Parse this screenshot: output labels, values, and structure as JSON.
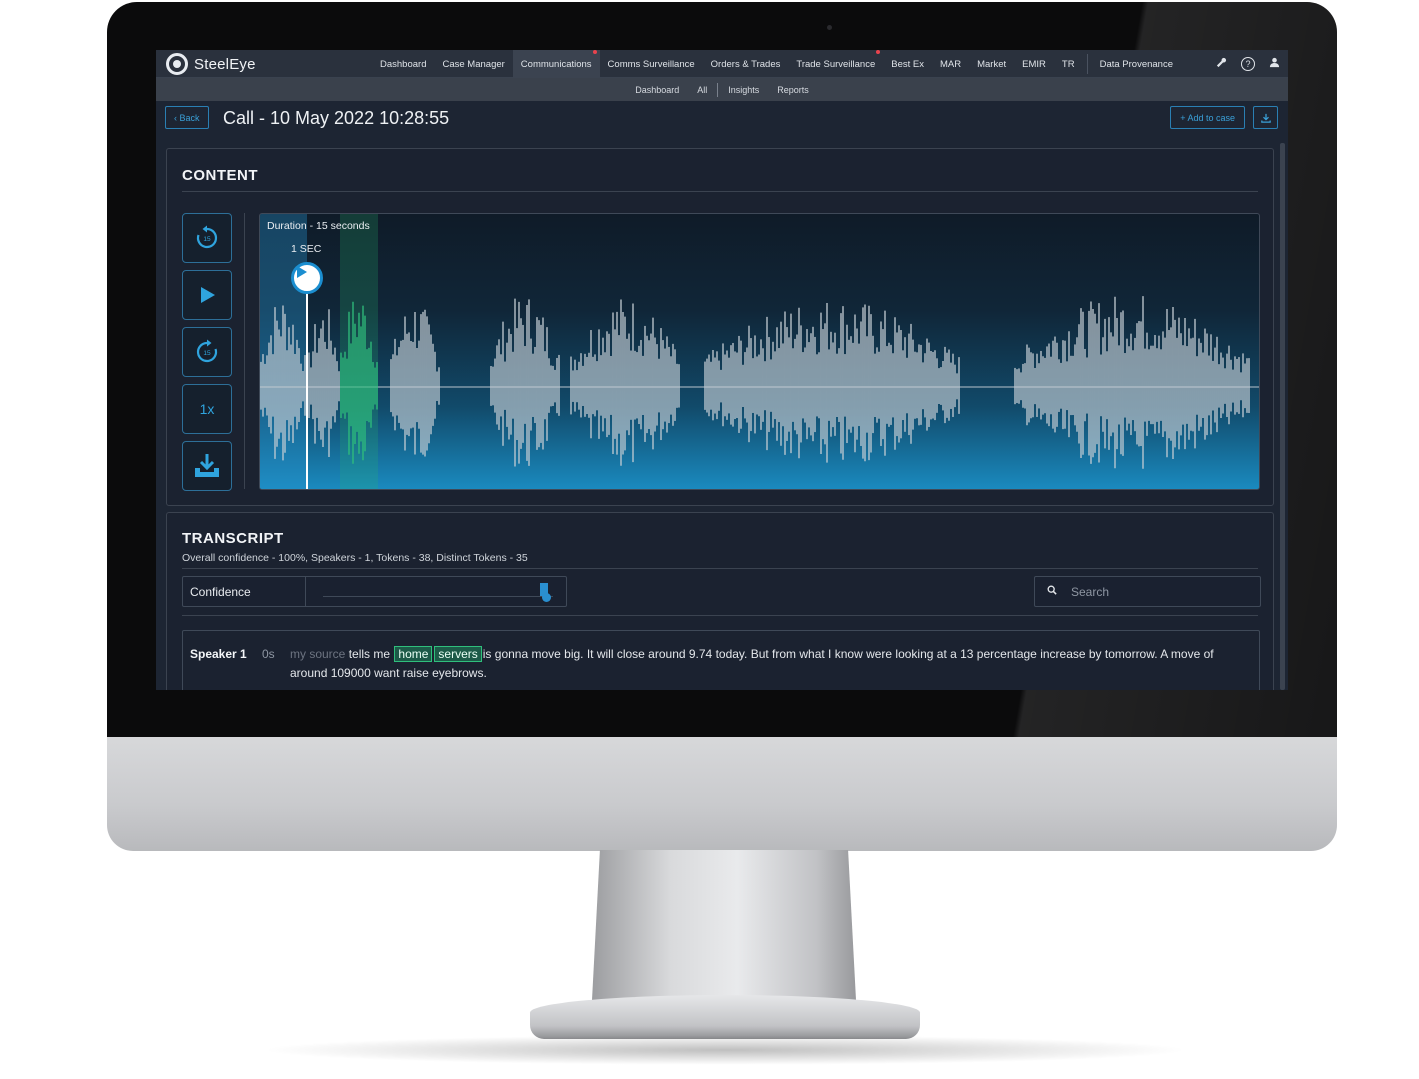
{
  "app": {
    "logo_text": "SteelEye"
  },
  "top_nav": {
    "items": [
      {
        "label": "Dashboard"
      },
      {
        "label": "Case Manager"
      },
      {
        "label": "Communications"
      },
      {
        "label": "Comms Surveillance"
      },
      {
        "label": "Orders & Trades"
      },
      {
        "label": "Trade Surveillance"
      },
      {
        "label": "Best Ex"
      },
      {
        "label": "MAR"
      },
      {
        "label": "Market"
      },
      {
        "label": "EMIR"
      },
      {
        "label": "TR"
      }
    ],
    "active_item": "Communications",
    "data_provenance": "Data Provenance",
    "icons": [
      "wrench-icon",
      "help-icon",
      "user-icon"
    ]
  },
  "sub_nav": {
    "items": [
      {
        "label": "Dashboard"
      },
      {
        "label": "All"
      },
      {
        "label": "Insights"
      },
      {
        "label": "Reports"
      }
    ]
  },
  "header": {
    "back_label": "‹ Back",
    "title": "Call - 10 May 2022 10:28:55",
    "add_to_case_label": "+ Add to case"
  },
  "content": {
    "heading": "CONTENT",
    "controls": [
      {
        "name": "rewind-15-icon"
      },
      {
        "name": "play-icon"
      },
      {
        "name": "forward-15-icon"
      },
      {
        "name": "speed",
        "label": "1x"
      },
      {
        "name": "download-icon"
      }
    ],
    "player": {
      "duration_label": "Duration - 15 seconds",
      "current_time_label": "1 SEC",
      "position_seconds": 1,
      "duration_seconds": 15
    }
  },
  "transcript": {
    "heading": "TRANSCRIPT",
    "summary": "Overall confidence - 100%, Speakers - 1, Tokens - 38, Distinct Tokens - 35",
    "confidence_label": "Confidence",
    "search_placeholder": "Search",
    "utterances": [
      {
        "speaker": "Speaker 1",
        "time": "0s",
        "faint_text": "my source",
        "pre_text": "tells me",
        "highlight_1": "home",
        "highlight_2": "servers",
        "post_text": "is gonna move big. It will close around 9.74 today. But from what I know were looking at a 13 percentage increase by tomorrow. A move of around 109000 want raise eyebrows."
      }
    ]
  },
  "colors": {
    "accent": "#2fa4de",
    "highlight": "#2fbf7c",
    "background": "#1d2533",
    "alert_dot": "#e8434d"
  }
}
